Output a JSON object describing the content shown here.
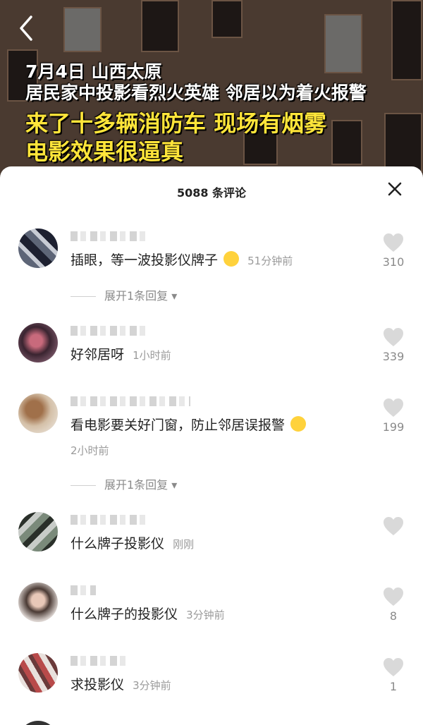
{
  "video": {
    "captions": [
      "7月4日 山西太原",
      "居民家中投影看烈火英雄 邻居以为着火报警",
      "来了十多辆消防车 现场有烟雾",
      "电影效果很逼真"
    ],
    "back_icon": "chevron-left-icon",
    "caption_color": "#ffe53a"
  },
  "sheet": {
    "title": "5088 条评论",
    "close_icon": "close-icon"
  },
  "comments": [
    {
      "text": "插眼，等一波投影仪牌子",
      "emoji": "pleading-face",
      "time": "51分钟前",
      "likes": "310",
      "expand": "展开1条回复"
    },
    {
      "text": "好邻居呀",
      "time": "1小时前",
      "likes": "339"
    },
    {
      "text": "看电影要关好门窗，防止邻居误报警",
      "emoji": "grinning-face",
      "time": "2小时前",
      "likes": "199",
      "expand": "展开1条回复"
    },
    {
      "text": "什么牌子投影仪",
      "time": "刚刚",
      "likes": ""
    },
    {
      "text": "什么牌子的投影仪",
      "time": "3分钟前",
      "likes": "8"
    },
    {
      "text": "求投影仪",
      "time": "3分钟前",
      "likes": "1"
    }
  ]
}
